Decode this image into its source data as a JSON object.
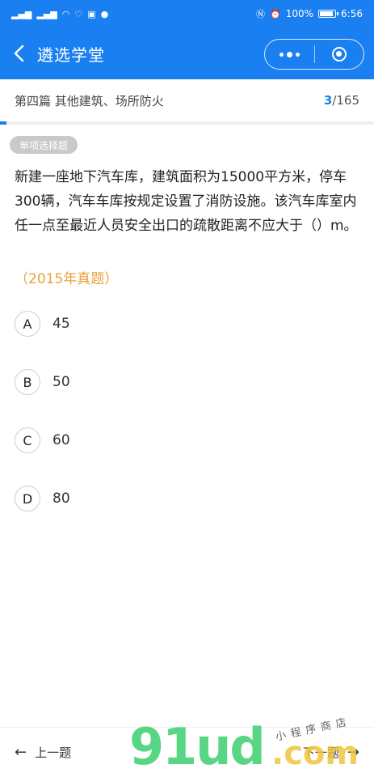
{
  "status": {
    "left_icons": [
      "sim-signal-icon",
      "sim-signal-icon",
      "wifi-icon",
      "health-icon",
      "app-icon",
      "chat-icon"
    ],
    "battery_text": "100%",
    "time": "6:56"
  },
  "nav": {
    "title": "遴选学堂"
  },
  "chapter": {
    "title": "第四篇 其他建筑、场所防火",
    "current": "3",
    "total": "/165",
    "progress_fraction": 0.018
  },
  "question": {
    "type": "单项选择题",
    "text": "新建一座地下汽车库，建筑面积为15000平方米，停车300辆，汽车车库按规定设置了消防设施。该汽车库室内任一点至最近人员安全出口的疏散距离不应大于（）m。",
    "source": "（2015年真题）",
    "options": [
      {
        "letter": "A",
        "text": "45"
      },
      {
        "letter": "B",
        "text": "50"
      },
      {
        "letter": "C",
        "text": "60"
      },
      {
        "letter": "D",
        "text": "80"
      }
    ]
  },
  "bottom": {
    "prev_label": "上一题",
    "next_label": "下一题"
  },
  "watermark": {
    "main": "91ud",
    "suffix": ".com",
    "caption": "小程序商店"
  },
  "colors": {
    "brand": "#1a7ff0",
    "source": "#e8a23a"
  }
}
